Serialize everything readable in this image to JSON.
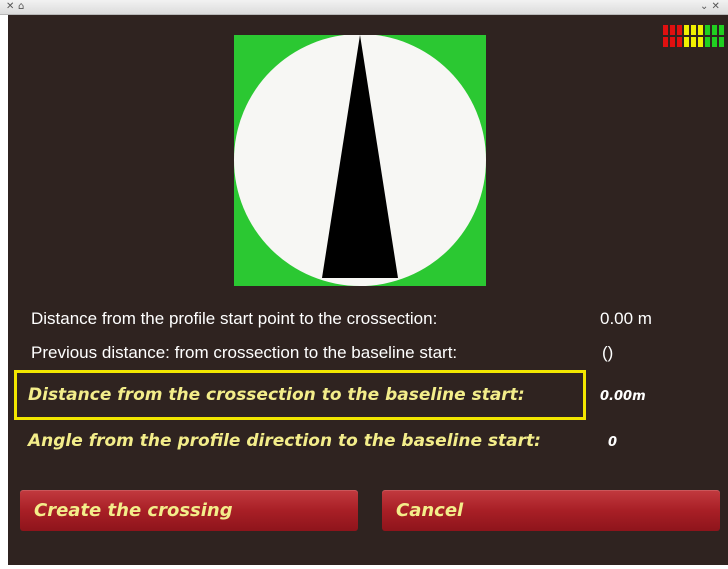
{
  "titlebar": {
    "close_glyph": "✕",
    "left_glyph": "⌂",
    "right_glyphs": "⌄ ✕"
  },
  "gauge": {
    "background_color": "#2bc832",
    "dial_color": "#f7f7f4",
    "needle_color": "#000000",
    "needle_angle_deg": 0
  },
  "level_meter": {
    "colors": [
      "#e01010",
      "#e01010",
      "#e01010",
      "#f0f000",
      "#f0f000",
      "#f0f000",
      "#20d020",
      "#20d020",
      "#20d020"
    ]
  },
  "info": {
    "distance_profile_label": "Distance from the profile start point to the crossection:",
    "distance_profile_value": "0.00 m",
    "previous_distance_label": "Previous distance: from crossection to the baseline start:",
    "previous_distance_value": "()"
  },
  "fields": {
    "distance_baseline_label": "Distance from the crossection to the baseline start:",
    "distance_baseline_value": "0.00m",
    "angle_label": "Angle from the profile direction to the baseline start:",
    "angle_value": "0"
  },
  "buttons": {
    "create_label": "Create the crossing",
    "cancel_label": "Cancel"
  }
}
